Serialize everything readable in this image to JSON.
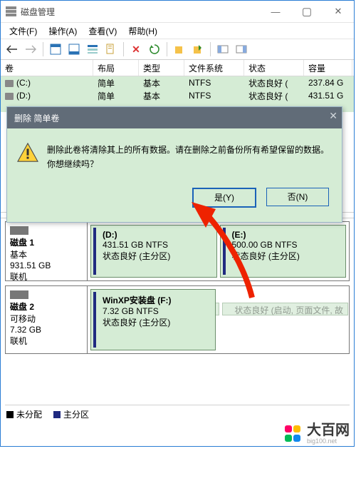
{
  "window": {
    "title": "磁盘管理"
  },
  "menu": {
    "file": "文件(F)",
    "op": "操作(A)",
    "view": "查看(V)",
    "help": "帮助(H)"
  },
  "columns": {
    "vol": "卷",
    "layout": "布局",
    "type": "类型",
    "fs": "文件系统",
    "state": "状态",
    "cap": "容量"
  },
  "volumes": [
    {
      "name": "(C:)",
      "layout": "简单",
      "type": "基本",
      "fs": "NTFS",
      "state": "状态良好 (",
      "cap": "237.84 G"
    },
    {
      "name": "(D:)",
      "layout": "简单",
      "type": "基本",
      "fs": "NTFS",
      "state": "状态良好 (",
      "cap": "431.51 G"
    }
  ],
  "dialog": {
    "title": "删除 简单卷",
    "message": "删除此卷将清除其上的所有数据。请在删除之前备份所有希望保留的数据。你想继续吗？",
    "yes": "是(Y)",
    "no": "否(N)"
  },
  "disk1": {
    "name": "磁盘 1",
    "kind": "基本",
    "size": "931.51 GB",
    "state": "联机",
    "ghost": "状态良好 (启动, 页面文件, 故",
    "p0": {
      "label": "(D:)",
      "line1": "431.51 GB NTFS",
      "line2": "状态良好 (主分区)"
    },
    "p1": {
      "label": "(E:)",
      "line1": "500.00 GB NTFS",
      "line2": "状态良好 (主分区)"
    }
  },
  "disk2": {
    "name": "磁盘 2",
    "kind": "可移动",
    "size": "7.32 GB",
    "state": "联机",
    "p0": {
      "label": "WinXP安装盘  (F:)",
      "line1": "7.32 GB NTFS",
      "line2": "状态良好 (主分区)"
    }
  },
  "legend": {
    "unalloc": "未分配",
    "primary": "主分区"
  },
  "watermark": {
    "brand": "大百网",
    "url": "big100.net"
  }
}
